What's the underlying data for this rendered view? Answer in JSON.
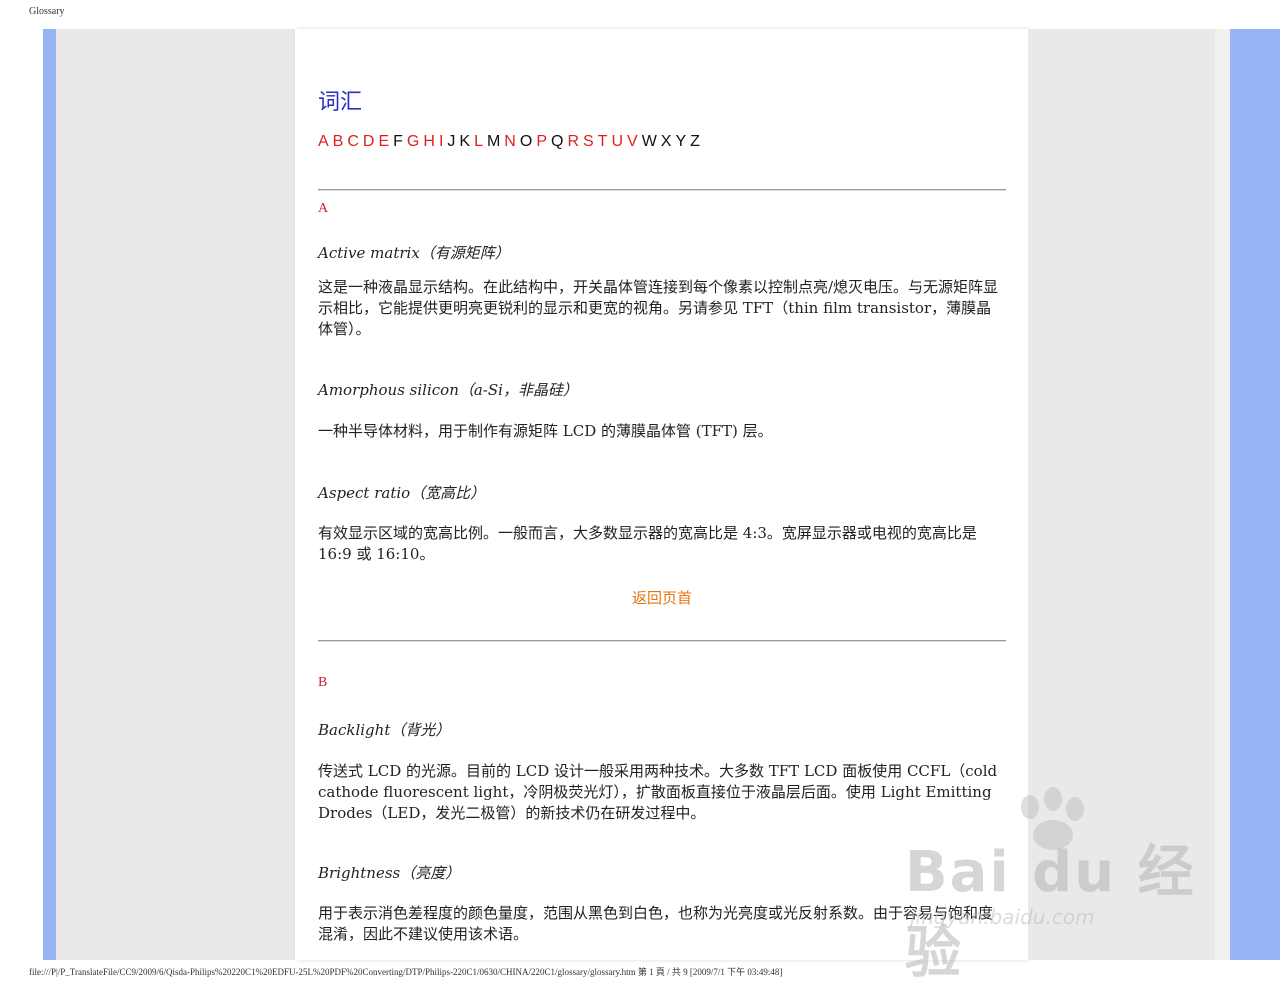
{
  "print_header": "Glossary",
  "page_title": "词汇",
  "alphabet": [
    {
      "letter": "A",
      "link": true
    },
    {
      "letter": "B",
      "link": true
    },
    {
      "letter": "C",
      "link": true
    },
    {
      "letter": "D",
      "link": true
    },
    {
      "letter": "E",
      "link": true
    },
    {
      "letter": "F",
      "link": false
    },
    {
      "letter": "G",
      "link": true
    },
    {
      "letter": "H",
      "link": true
    },
    {
      "letter": "I",
      "link": true
    },
    {
      "letter": "J",
      "link": false
    },
    {
      "letter": "K",
      "link": false
    },
    {
      "letter": "L",
      "link": true
    },
    {
      "letter": "M",
      "link": false
    },
    {
      "letter": "N",
      "link": true
    },
    {
      "letter": "O",
      "link": false
    },
    {
      "letter": "P",
      "link": true
    },
    {
      "letter": "Q",
      "link": false
    },
    {
      "letter": "R",
      "link": true
    },
    {
      "letter": "S",
      "link": true
    },
    {
      "letter": "T",
      "link": true
    },
    {
      "letter": "U",
      "link": true
    },
    {
      "letter": "V",
      "link": true
    },
    {
      "letter": "W",
      "link": false
    },
    {
      "letter": "X",
      "link": false
    },
    {
      "letter": "Y",
      "link": false
    },
    {
      "letter": "Z",
      "link": false
    }
  ],
  "sections": {
    "a": {
      "letter": "A",
      "entries": [
        {
          "term": "Active matrix（有源矩阵）",
          "desc": "这是一种液晶显示结构。在此结构中，开关晶体管连接到每个像素以控制点亮/熄灭电压。与无源矩阵显示相比，它能提供更明亮更锐利的显示和更宽的视角。另请参见 TFT（thin film transistor，薄膜晶体管）。"
        },
        {
          "term": "Amorphous silicon（a-Si，非晶硅）",
          "desc": "一种半导体材料，用于制作有源矩阵 LCD 的薄膜晶体管 (TFT) 层。"
        },
        {
          "term": "Aspect ratio（宽高比）",
          "desc": "有效显示区域的宽高比例。一般而言，大多数显示器的宽高比是 4:3。宽屏显示器或电视的宽高比是 16:9 或 16:10。"
        }
      ]
    },
    "b": {
      "letter": "B",
      "entries": [
        {
          "term": "Backlight（背光）",
          "desc": "传送式 LCD 的光源。目前的 LCD 设计一般采用两种技术。大多数 TFT LCD 面板使用 CCFL（cold cathode fluorescent light，冷阴极荧光灯），扩散面板直接位于液晶层后面。使用 Light Emitting Drodes（LED，发光二极管）的新技术仍在研发过程中。"
        },
        {
          "term": "Brightness（亮度）",
          "desc": "用于表示消色差程度的颜色量度，范围从黑色到白色，也称为光亮度或光反射系数。由于容易与饱和度混淆，因此不建议使用该术语。"
        }
      ]
    }
  },
  "back_to_top": "返回页首",
  "watermark": {
    "text": "Bai du 经验",
    "url": "jingyan.baidu.com"
  },
  "print_footer": "file:///P|/P_TranslateFile/CC9/2009/6/Qisda-Philips%20220C1%20EDFU-25L%20PDF%20Converting/DTP/Philips-220C1/0630/CHINA/220C1/glossary/glossary.htm 第 1 頁 / 共 9  [2009/7/1 下午 03:49:48]"
}
